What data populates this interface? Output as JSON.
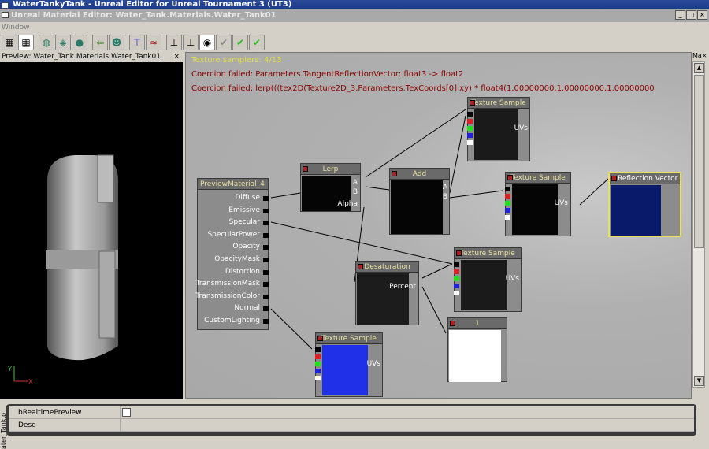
{
  "window": {
    "title": "WaterTankyTank - Unreal Editor for Unreal Tournament 3 (UT3)",
    "editor_title": "Unreal Material Editor: Water_Tank.Materials.Water_Tank01",
    "buttons": [
      "_",
      "□",
      "×"
    ]
  },
  "menu": {
    "items": [
      "Window"
    ]
  },
  "toolbar": {
    "icons": [
      "home-icon",
      "grid-icon",
      "cylinder-icon",
      "cube-icon",
      "sphere-icon",
      "back-arrow-icon",
      "skull-icon",
      "pin-top-icon",
      "curve-icon",
      "node-icon",
      "node-alt-icon",
      "eye-icon",
      "check-gray-icon",
      "check-green-icon",
      "check-green-icon-2"
    ],
    "glyphs": [
      "▦",
      "▦",
      "◍",
      "◈",
      "●",
      "⇦",
      "☻",
      "⊤",
      "≈",
      "⊥",
      "⊥",
      "◉",
      "✔",
      "✔",
      "✔"
    ]
  },
  "preview": {
    "title": "Preview: Water_Tank.Materials.Water_Tank01",
    "close": "×",
    "axis": {
      "y": "Y",
      "x": "X"
    }
  },
  "graph": {
    "panel_label": "Ma",
    "panel_close": "×",
    "messages": {
      "samplers": "Texture samplers: 4/13",
      "error1": "Coercion failed: Parameters.TangentReflectionVector: float3 -> float2",
      "error2": "Coercion failed: lerp(((tex2D(Texture2D_3,Parameters.TexCoords[0].xy) * float4(1.00000000,1.00000000,1.00000000"
    },
    "material": {
      "title": "PreviewMaterial_4",
      "inputs": [
        "Diffuse",
        "Emissive",
        "Specular",
        "SpecularPower",
        "Opacity",
        "OpacityMask",
        "Distortion",
        "TransmissionMask",
        "TransmissionColor",
        "Normal",
        "CustomLighting"
      ]
    },
    "lerp": {
      "title": "Lerp",
      "inputs": [
        "A",
        "B",
        "Alpha"
      ]
    },
    "add": {
      "title": "Add",
      "inputs": [
        "A",
        "B"
      ]
    },
    "tex1": {
      "title": "Texture Sample",
      "uvs": "UVs"
    },
    "tex2": {
      "title": "Texture Sample",
      "uvs": "UVs"
    },
    "tex3": {
      "title": "Texture Sample",
      "uvs": "UVs"
    },
    "tex4": {
      "title": "Texture Sample",
      "uvs": "UVs"
    },
    "reflection": {
      "title": "Reflection Vector"
    },
    "desat": {
      "title": "Desaturation",
      "percent": "Percent"
    },
    "constant": {
      "title": "1"
    },
    "colors": {
      "error": "#8b0000",
      "info": "#e0e040",
      "reflection_border": "#e8e060"
    }
  },
  "properties": {
    "side_tab": "ater_Tank.p",
    "rows": [
      {
        "name": "bRealtimePreview",
        "value": false
      },
      {
        "name": "Desc",
        "value": ""
      }
    ]
  }
}
